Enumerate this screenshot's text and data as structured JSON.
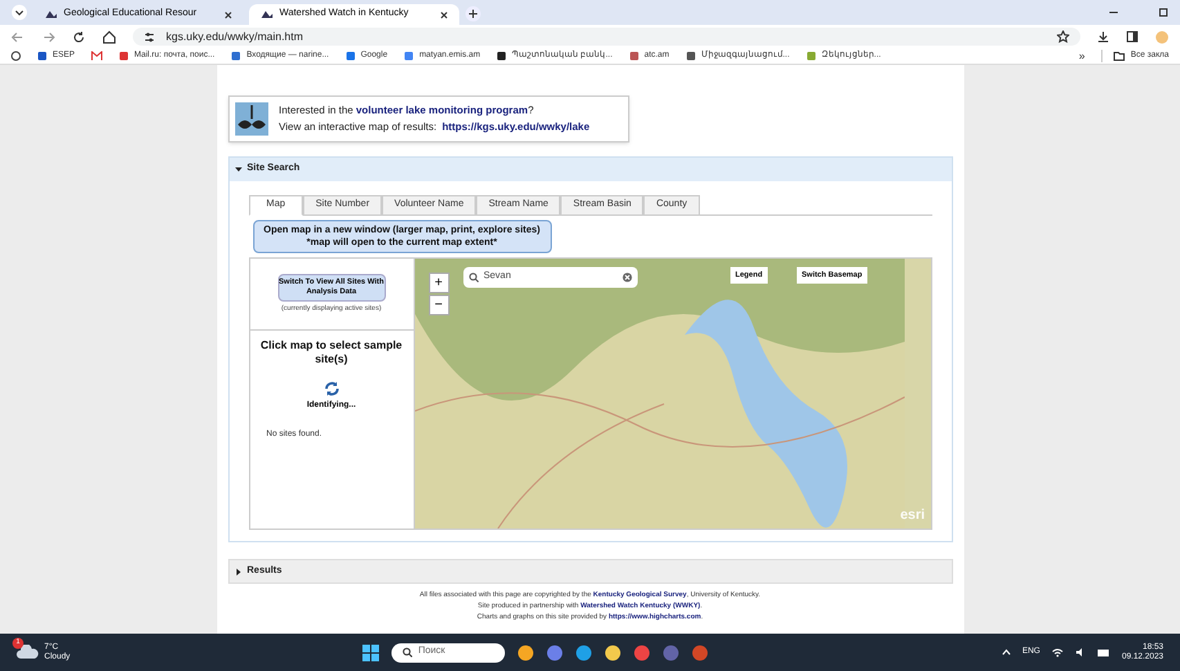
{
  "browser": {
    "tabs": [
      {
        "title": "Geological Educational Resour",
        "selected": false
      },
      {
        "title": "Watershed Watch in Kentucky",
        "selected": true
      }
    ],
    "url": "kgs.uky.edu/wwky/main.htm",
    "bookmarks": [
      {
        "label": "ESEP"
      },
      {
        "label": "Mail.ru: почта, поис..."
      },
      {
        "label": "Входящие — narine..."
      },
      {
        "label": "Google"
      },
      {
        "label": "matyan.emis.am"
      },
      {
        "label": "Պաշտոնական բանկ..."
      },
      {
        "label": "atc.am"
      },
      {
        "label": "Միջազգայնացում..."
      },
      {
        "label": "Զեկույցներ..."
      }
    ],
    "bookmarks_more": "»",
    "bookmarks_folder": "Все закла"
  },
  "lake_box": {
    "line1": "Interested in the **volunteer lake monitoring program**?",
    "line2_text": "View an interactive map of results:",
    "line2_link": "https://kgs.uky.edu/wwky/lake"
  },
  "site_search": {
    "title": "Site Search",
    "expanded": true,
    "tabs": [
      {
        "label": "Map",
        "selected": true
      },
      {
        "label": "Site Number",
        "selected": false
      },
      {
        "label": "Volunteer Name",
        "selected": false
      },
      {
        "label": "Stream Name",
        "selected": false
      },
      {
        "label": "Stream Basin",
        "selected": false
      },
      {
        "label": "County",
        "selected": false
      }
    ],
    "open_map_button": {
      "line1": "Open map in a new window (larger map, print, explore sites)",
      "line2": "*map will open to the current map extent*"
    },
    "switch_button": "Switch To View All Sites With Analysis Data",
    "switch_note": "(currently displaying active sites)",
    "instruction": "Click map to select sample site(s)",
    "status": "Identifying...",
    "result": "No sites found.",
    "map": {
      "search_value": "Sevan",
      "zoom_in": "+",
      "zoom_out": "−",
      "legend": "Legend",
      "basemap": "Switch Basemap",
      "attribution": "esri"
    }
  },
  "results": {
    "title": "Results",
    "expanded": false
  },
  "footer": [
    "All files associated with this page are copyrighted by the **Kentucky Geological Survey**, University of Kentucky.",
    "Site produced in partnership with **Watershed Watch Kentucky (WWKY)**.",
    "Charts and graphs on this site provided by **https://www.highcharts.com**."
  ],
  "taskbar": {
    "weather_temp": "7°C",
    "weather_text": "Cloudy",
    "weather_badge": "1",
    "search_placeholder": "Поиск",
    "language": "ENG",
    "time": "18:53",
    "date": "09.12.2023"
  }
}
